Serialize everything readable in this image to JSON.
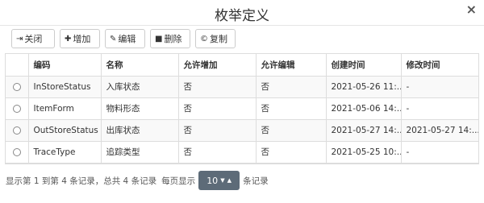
{
  "dialog": {
    "title": "枚举定义",
    "close_glyph": "×"
  },
  "toolbar": {
    "close_label": "关闭",
    "add_label": "增加",
    "edit_label": "编辑",
    "delete_label": "删除",
    "copy_label": "复制"
  },
  "table": {
    "columns": [
      "编码",
      "名称",
      "允许增加",
      "允许编辑",
      "创建时间",
      "修改时间"
    ],
    "rows": [
      [
        "InStoreStatus",
        "入库状态",
        "否",
        "否",
        "2021-05-26 11:...",
        "-"
      ],
      [
        "ItemForm",
        "物料形态",
        "否",
        "否",
        "2021-05-06 14:...",
        "-"
      ],
      [
        "OutStoreStatus",
        "出库状态",
        "否",
        "否",
        "2021-05-27 14:...",
        "2021-05-27 14:..."
      ],
      [
        "TraceType",
        "追踪类型",
        "否",
        "否",
        "2021-05-25 10:...",
        "-"
      ]
    ]
  },
  "pager": {
    "summary": "显示第 1 到第 4 条记录，总共 4 条记录",
    "per_page_prefix": "每页显示",
    "page_size": "10",
    "per_page_suffix": "条记录"
  }
}
